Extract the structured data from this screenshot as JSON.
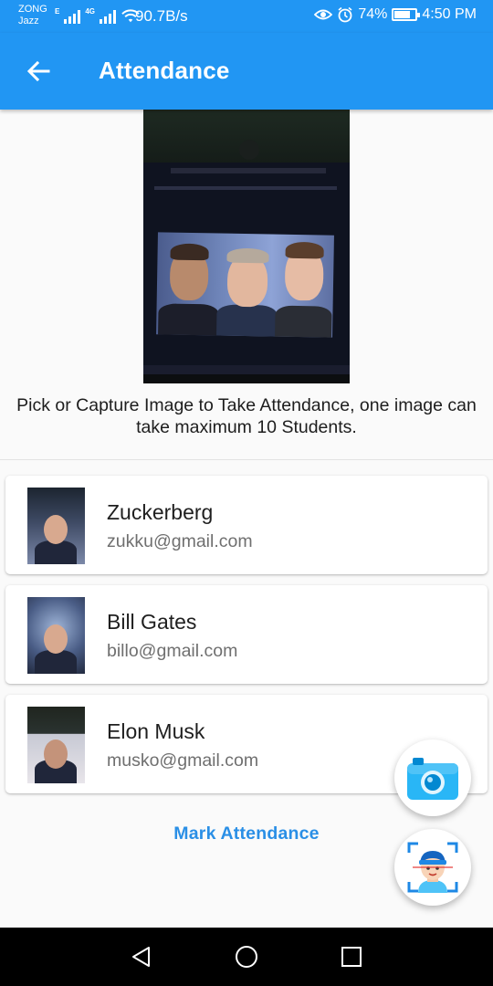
{
  "status_bar": {
    "carrier_top": "ZONG",
    "carrier_bottom": "Jazz",
    "network_1": "E",
    "network_2": "4G",
    "net_speed": "90.7B/s",
    "battery": "74%",
    "time": "4:50 PM",
    "battery_level": 0.74
  },
  "app_bar": {
    "title": "Attendance",
    "back_icon": "arrow-back-icon"
  },
  "captured_image": {
    "description_icon": "captured-photo"
  },
  "instruction": "Pick or Capture Image to Take Attendance, one image can take maximum 10 Students.",
  "students": [
    {
      "name": "Zuckerberg",
      "email": "zukku@gmail.com"
    },
    {
      "name": "Bill Gates",
      "email": "billo@gmail.com"
    },
    {
      "name": "Elon Musk",
      "email": "musko@gmail.com"
    }
  ],
  "mark_attendance_label": "Mark Attendance",
  "fabs": {
    "camera_icon": "camera-icon",
    "face_scan_icon": "face-scan-icon"
  },
  "colors": {
    "primary": "#2196f3",
    "accent_text": "#2a8fe6"
  }
}
